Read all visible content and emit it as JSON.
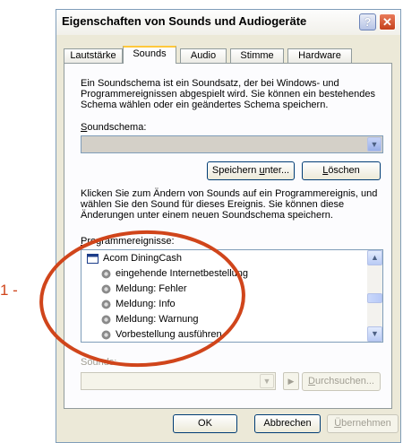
{
  "window": {
    "title": "Eigenschaften von Sounds und Audiogeräte",
    "help_glyph": "?",
    "close_glyph": "✕"
  },
  "tabs": [
    "Lautstärke",
    "Sounds",
    "Audio",
    "Stimme",
    "Hardware"
  ],
  "active_tab": "Sounds",
  "intro_text": "Ein Soundschema ist ein Soundsatz, der bei Windows- und Programmereignissen abgespielt wird. Sie können ein bestehendes Schema wählen oder ein geändertes Schema speichern.",
  "scheme": {
    "label_accel": "S",
    "label_rest": "oundschema:",
    "value": "",
    "save_button": {
      "accel": "Speichern ",
      "accel_char": "u",
      "rest": "nter..."
    },
    "delete_button": {
      "accel_char": "L",
      "rest": "öschen"
    }
  },
  "events_text": "Klicken Sie zum Ändern von Sounds auf ein Programmereignis, und wählen Sie den Sound für dieses Ereignis. Sie können diese Änderungen unter einem neuen Soundschema speichern.",
  "events": {
    "label_accel": "P",
    "label_rest": "rogrammereignisse:",
    "items": [
      {
        "text": "Acom DiningCash",
        "icon": "application-window-icon"
      },
      {
        "text": "eingehende Internetbestellung",
        "icon": "speaker-icon"
      },
      {
        "text": "Meldung: Fehler",
        "icon": "speaker-icon"
      },
      {
        "text": "Meldung: Info",
        "icon": "speaker-icon"
      },
      {
        "text": "Meldung: Warnung",
        "icon": "speaker-icon"
      },
      {
        "text": "Vorbestellung ausführen",
        "icon": "speaker-icon"
      }
    ]
  },
  "sounds": {
    "label": "Sounds:",
    "value": "",
    "browse_button": {
      "accel_char": "D",
      "rest": "urchsuchen..."
    }
  },
  "footer": {
    "ok": "OK",
    "cancel": "Abbrechen",
    "apply_accel": "Ü",
    "apply_rest": "bernehmen"
  },
  "annotation": {
    "label": "1 -",
    "color": "#d0451b"
  }
}
